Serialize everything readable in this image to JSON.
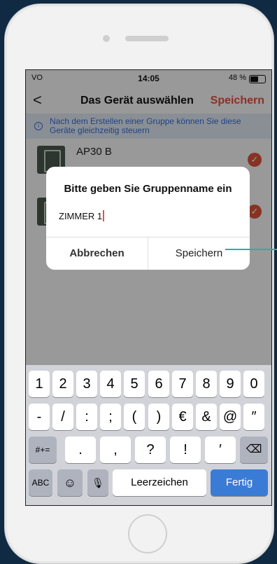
{
  "status": {
    "carrier": "VO",
    "time": "14:05",
    "battery": "48 %"
  },
  "nav": {
    "back": "<",
    "title": "Das Gerät auswählen",
    "save": "Speichern"
  },
  "info": {
    "text": "Nach dem Erstellen einer Gruppe können Sie diese Geräte gleichzeitig steuern"
  },
  "devices": [
    {
      "name": "AP30 B"
    },
    {
      "name": ""
    }
  ],
  "dialog": {
    "title": "Bitte geben Sie Gruppenname ein",
    "value": "ZIMMER 1",
    "cancel": "Abbrechen",
    "save": "Speichern"
  },
  "keyboard": {
    "row1": [
      "1",
      "2",
      "3",
      "4",
      "5",
      "6",
      "7",
      "8",
      "9",
      "0"
    ],
    "row2": [
      "-",
      "/",
      ":",
      ";",
      "(",
      ")",
      "€",
      "&",
      "@",
      "″"
    ],
    "row3": [
      "#+=",
      ".",
      ",",
      "?",
      "!",
      "′",
      "⌫"
    ],
    "row4": [
      "ABC",
      "☺",
      "🎙",
      "Leerzeichen",
      "Fertig"
    ]
  },
  "colors": {
    "accent": "#e2553b",
    "info": "#3a6fd8",
    "done": "#3a7bd5",
    "callout": "#25b3a0"
  }
}
